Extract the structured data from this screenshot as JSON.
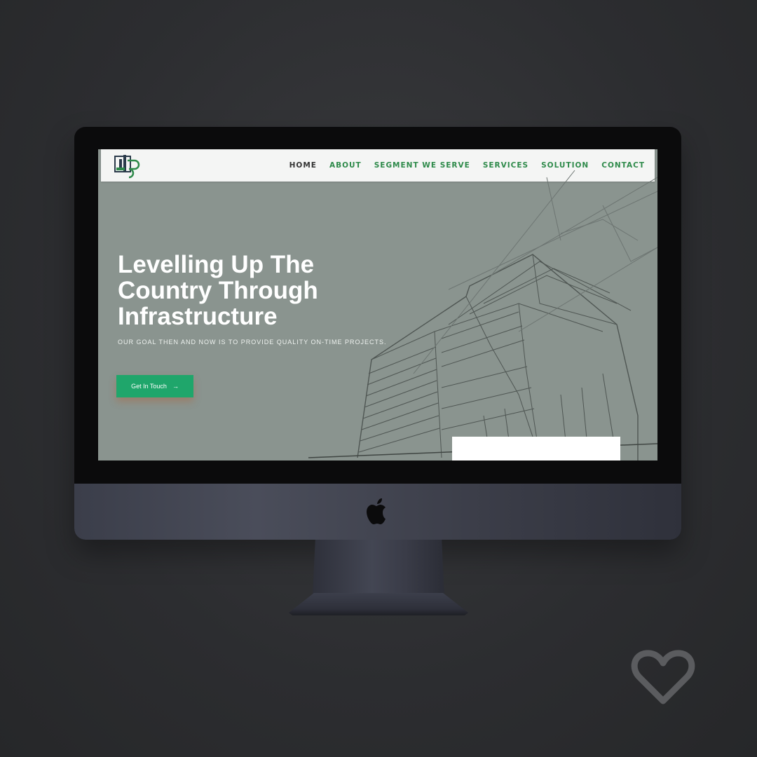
{
  "nav": {
    "items": [
      {
        "label": "HOME",
        "active": true
      },
      {
        "label": "ABOUT",
        "active": false
      },
      {
        "label": "SEGMENT WE SERVE",
        "active": false
      },
      {
        "label": "SERVICES",
        "active": false
      },
      {
        "label": "SOLUTION",
        "active": false
      },
      {
        "label": "CONTACT",
        "active": false
      }
    ]
  },
  "hero": {
    "title_lines": [
      "Levelling Up The",
      "Country Through",
      "Infrastructure"
    ],
    "subtitle": "OUR GOAL THEN AND NOW IS TO PROVIDE QUALITY ON-TIME PROJECTS.",
    "cta_label": "Get In Touch",
    "cta_arrow": "→"
  },
  "colors": {
    "brand_green": "#2e8a4a",
    "cta_green": "#1fa66b",
    "hero_bg": "#8a948f",
    "page_bg": "#2c2d30"
  },
  "icons": {
    "brand_logo": "company-logo-icon",
    "device_logo": "apple-logo-icon",
    "favorite": "heart-icon"
  }
}
